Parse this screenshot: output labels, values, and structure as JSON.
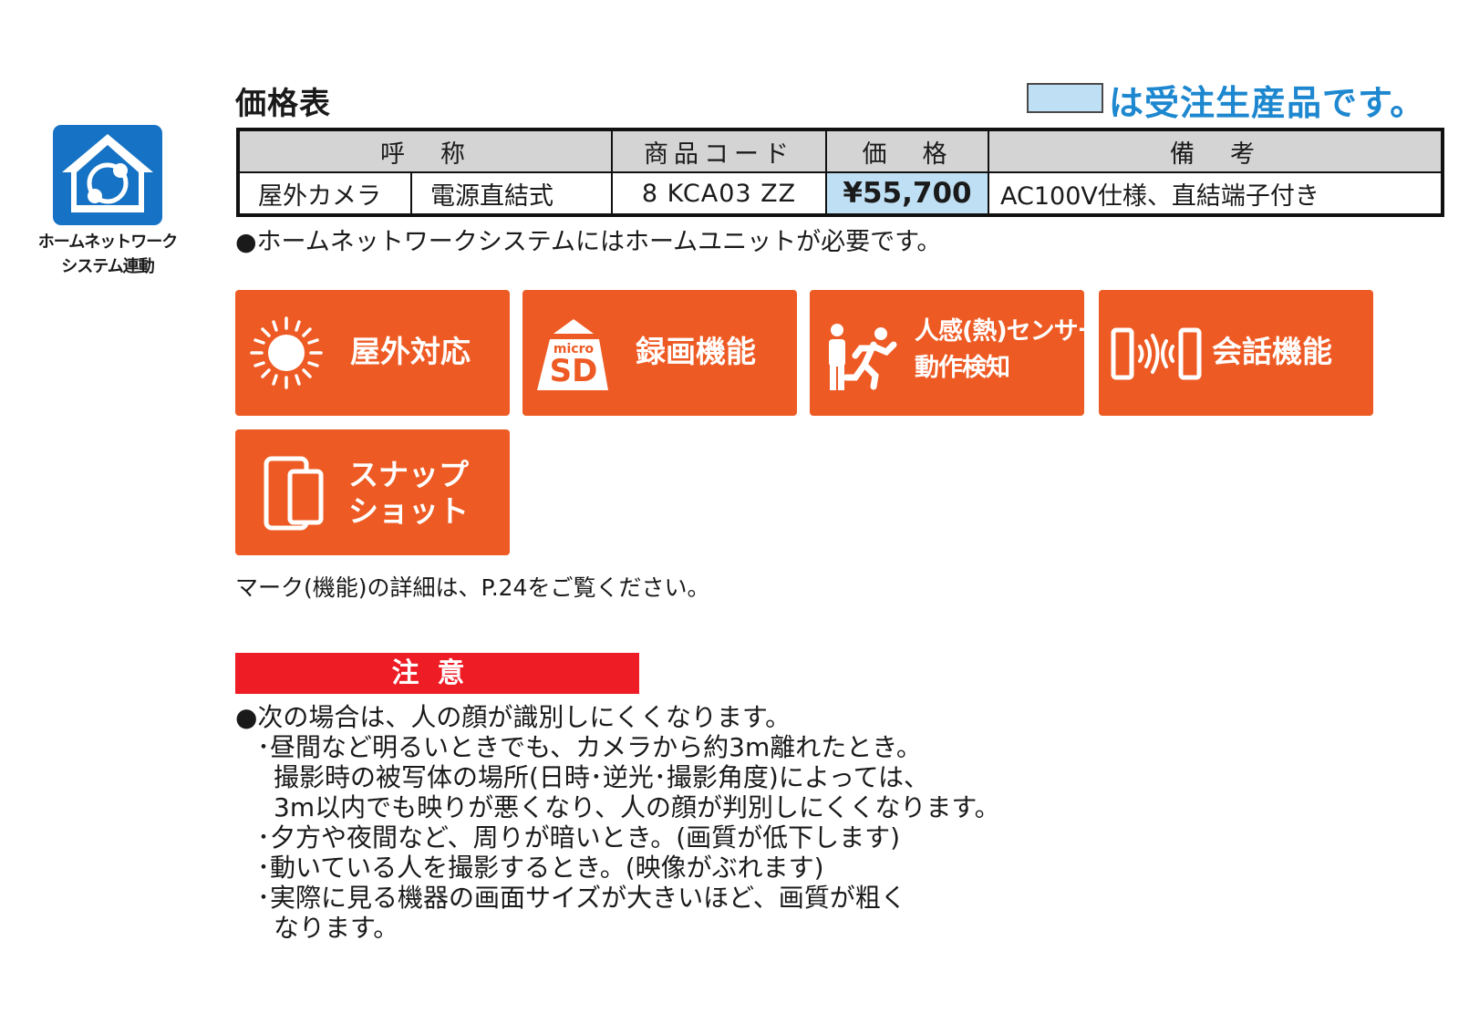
{
  "badge": {
    "icon": "home-network-icon",
    "line1": "ホームネットワーク",
    "line2": "システム連動",
    "color": "#1572c4"
  },
  "header": {
    "title": "価格表",
    "legend_text": "は受注生産品です。",
    "legend_color": "#bfe0f4"
  },
  "price_table": {
    "headers": [
      "呼　称",
      "商品コード",
      "価　格",
      "備　考"
    ],
    "row": {
      "name_1": "屋外カメラ",
      "name_2": "電源直結式",
      "code": "8 KCA03 ZZ",
      "price": "¥55,700",
      "note": "AC100V仕様、直結端子付き"
    }
  },
  "table_note": "●ホームネットワークシステムにはホームユニットが必要です。",
  "features": {
    "color": "#ee5a23",
    "items": [
      {
        "label": "屋外対応",
        "icon": "sun-icon"
      },
      {
        "label": "録画機能",
        "icon": "microsd-icon",
        "icon_text_1": "micro",
        "icon_text_2": "SD"
      },
      {
        "label_1": "人感(熱)センサー",
        "label_2": "動作検知",
        "icon": "motion-sensor-icon"
      },
      {
        "label": "会話機能",
        "icon": "speaker-phone-icon"
      },
      {
        "label_1": "スナップ",
        "label_2": "ショット",
        "icon": "smartphone-icon"
      }
    ]
  },
  "mark_note": "マーク(機能)の詳細は、P.24をご覧ください。",
  "caution": {
    "title": "注意",
    "color": "#ee1c25",
    "lead": "●次の場合は、人の顔が識別しにくくなります。",
    "lines": [
      "･昼間など明るいときでも、カメラから約3m離れたとき。",
      "撮影時の被写体の場所(日時･逆光･撮影角度)によっては、",
      "3m以内でも映りが悪くなり、人の顔が判別しにくくなります。",
      "･夕方や夜間など、周りが暗いとき。(画質が低下します)",
      "･動いている人を撮影するとき。(映像がぶれます)",
      "･実際に見る機器の画面サイズが大きいほど、画質が粗く",
      "なります。"
    ]
  }
}
